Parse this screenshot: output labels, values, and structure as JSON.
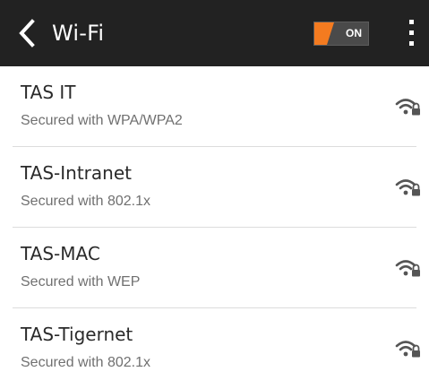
{
  "header": {
    "title": "Wi-Fi",
    "toggle_label": "ON",
    "toggle_state": "on",
    "accent_color": "#f47b20"
  },
  "networks": [
    {
      "name": "TAS IT",
      "security": "Secured with WPA/WPA2",
      "icon": "wifi-lock-icon"
    },
    {
      "name": "TAS-Intranet",
      "security": "Secured with 802.1x",
      "icon": "wifi-lock-icon"
    },
    {
      "name": "TAS-MAC",
      "security": "Secured with WEP",
      "icon": "wifi-lock-icon"
    },
    {
      "name": "TAS-Tigernet",
      "security": "Secured with 802.1x",
      "icon": "wifi-lock-icon"
    }
  ]
}
